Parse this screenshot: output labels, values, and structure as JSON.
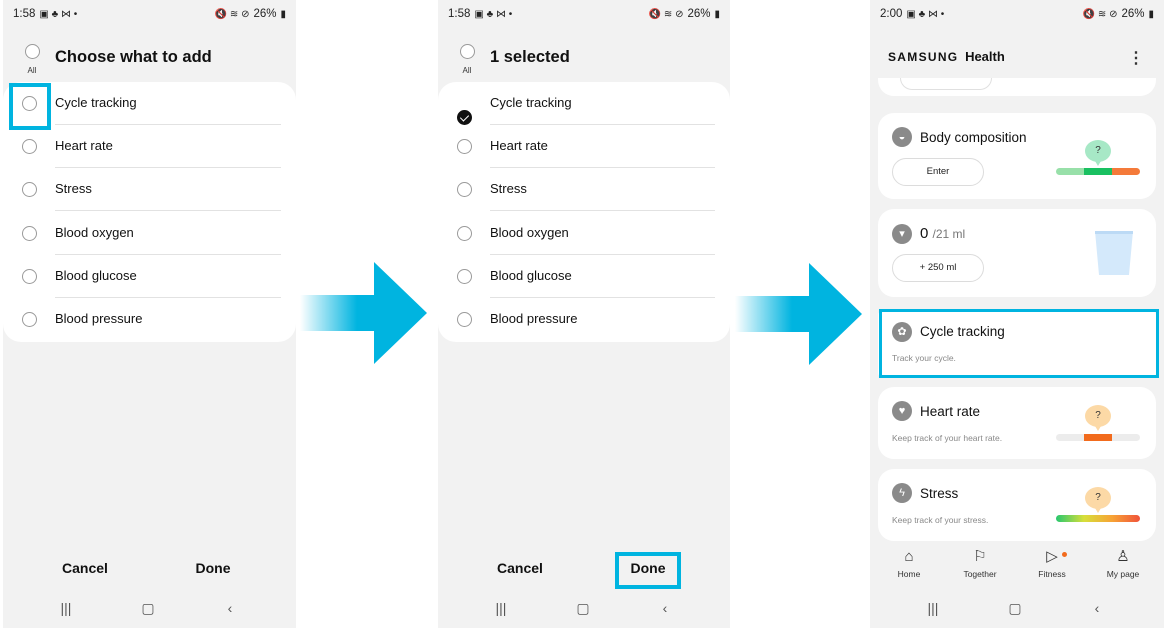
{
  "screen1": {
    "status": {
      "time": "1:58",
      "battery": "26%"
    },
    "all_label": "All",
    "title": "Choose what to add",
    "items": [
      "Cycle tracking",
      "Heart rate",
      "Stress",
      "Blood oxygen",
      "Blood glucose",
      "Blood pressure"
    ],
    "cancel_label": "Cancel",
    "done_label": "Done"
  },
  "screen2": {
    "status": {
      "time": "1:58",
      "battery": "26%"
    },
    "all_label": "All",
    "title": "1 selected",
    "items": [
      "Cycle tracking",
      "Heart rate",
      "Stress",
      "Blood oxygen",
      "Blood glucose",
      "Blood pressure"
    ],
    "checked_item": "Cycle tracking",
    "cancel_label": "Cancel",
    "done_label": "Done"
  },
  "screen3": {
    "status": {
      "time": "2:00",
      "battery": "26%"
    },
    "brand": "SAMSUNG",
    "product": "Health",
    "body_composition": {
      "title": "Body composition",
      "button": "Enter",
      "marker": "?"
    },
    "water": {
      "value": "0",
      "goal": "/21 ml",
      "button": "+ 250 ml"
    },
    "cycle_tracking": {
      "title": "Cycle tracking",
      "subtitle": "Track your cycle."
    },
    "heart_rate": {
      "title": "Heart rate",
      "subtitle": "Keep track of your heart rate.",
      "marker": "?"
    },
    "stress": {
      "title": "Stress",
      "subtitle": "Keep track of your stress.",
      "marker": "?"
    },
    "nav": [
      {
        "label": "Home",
        "icon": "home-icon"
      },
      {
        "label": "Together",
        "icon": "flag-icon"
      },
      {
        "label": "Fitness",
        "icon": "fitness-icon"
      },
      {
        "label": "My page",
        "icon": "person-icon"
      }
    ]
  },
  "colors": {
    "highlight": "#00b4e0",
    "arrow": "#00b4e0",
    "notification": "#f26b1d"
  }
}
